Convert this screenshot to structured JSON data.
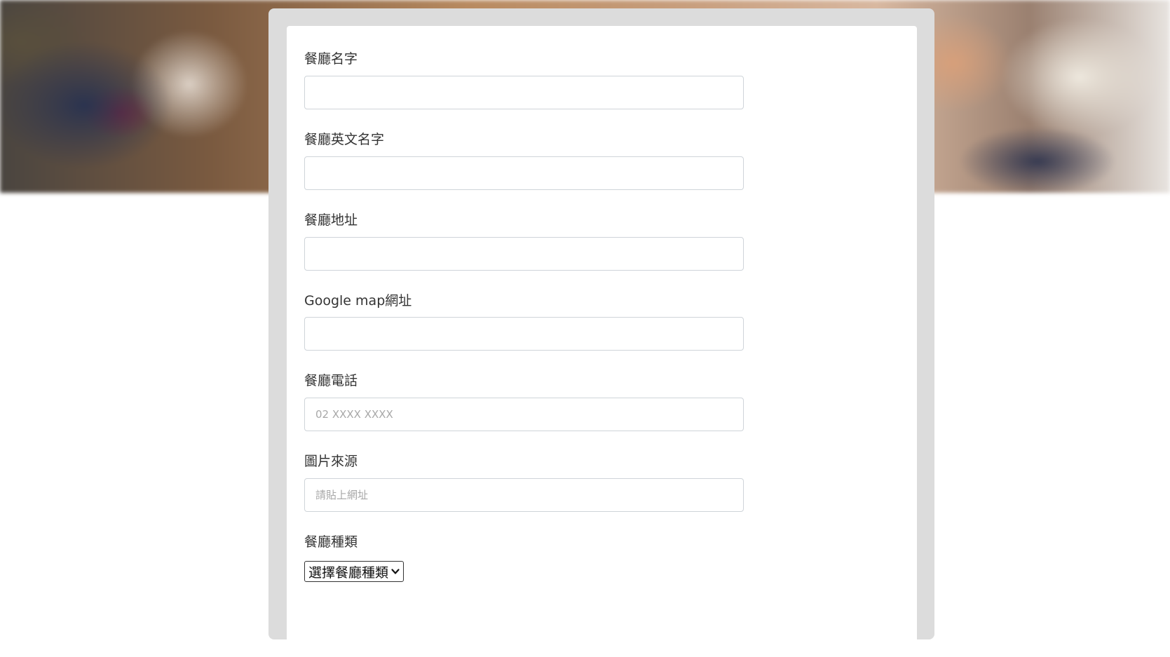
{
  "form": {
    "fields": [
      {
        "label": "餐廳名字",
        "placeholder": "",
        "value": ""
      },
      {
        "label": "餐廳英文名字",
        "placeholder": "",
        "value": ""
      },
      {
        "label": "餐廳地址",
        "placeholder": "",
        "value": ""
      },
      {
        "label": "Google map網址",
        "placeholder": "",
        "value": ""
      },
      {
        "label": "餐廳電話",
        "placeholder": "02 XXXX XXXX",
        "value": ""
      },
      {
        "label": "圖片來源",
        "placeholder": "請貼上網址",
        "value": ""
      }
    ],
    "category": {
      "label": "餐廳種類",
      "selected": "選擇餐廳種類",
      "icon": "chevron-down-icon"
    }
  },
  "colors": {
    "panel_border": "#dcdcdc",
    "input_border": "#cfd4d9",
    "label_text": "#333333",
    "placeholder_text": "#a8a8a8"
  }
}
